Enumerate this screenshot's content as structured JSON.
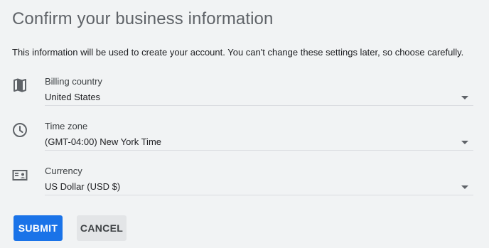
{
  "dialog": {
    "title": "Confirm your business information",
    "description": "This information will be used to create your account. You can't change these settings later, so choose carefully."
  },
  "fields": [
    {
      "label": "Billing country",
      "value": "United States",
      "icon": "map-icon"
    },
    {
      "label": "Time zone",
      "value": "(GMT-04:00) New York Time",
      "icon": "clock-icon"
    },
    {
      "label": "Currency",
      "value": "US Dollar (USD $)",
      "icon": "currency-icon"
    }
  ],
  "actions": {
    "submit_label": "SUBMIT",
    "cancel_label": "CANCEL"
  },
  "colors": {
    "primary": "#1a73e8",
    "background": "#f1f3f4",
    "text": "#202124",
    "secondary_text": "#5f6368"
  }
}
